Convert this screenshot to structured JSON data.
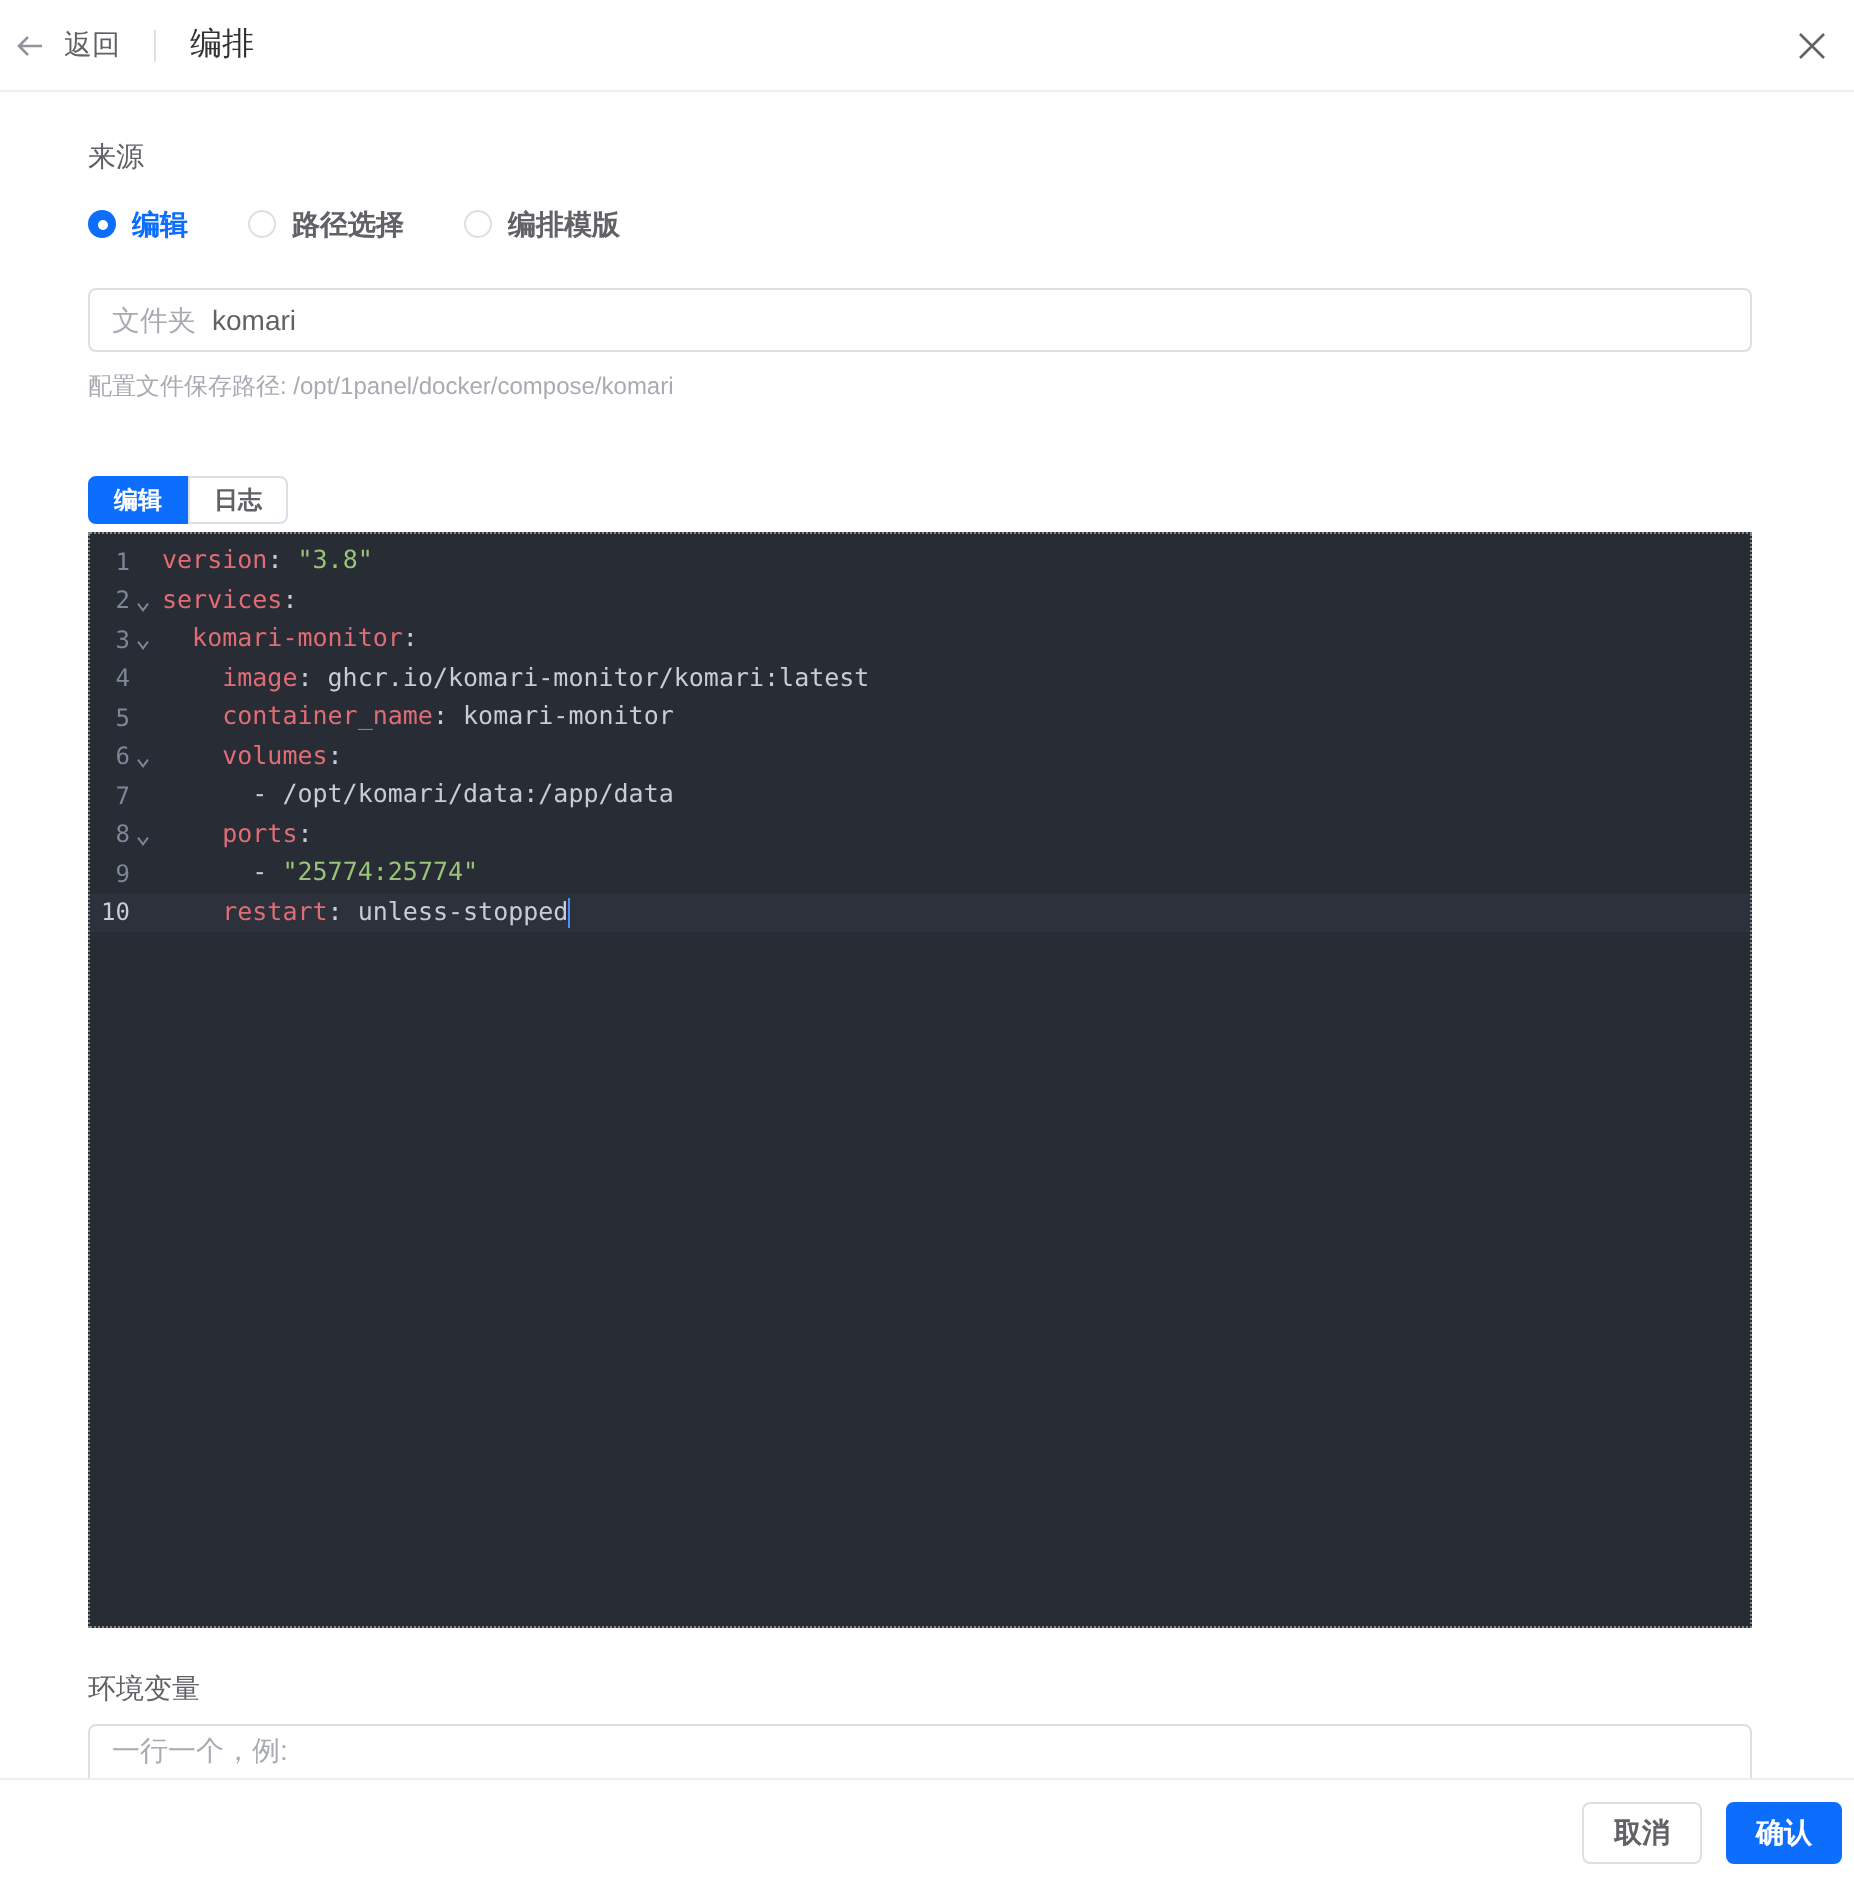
{
  "header": {
    "back": "返回",
    "title": "编排"
  },
  "source": {
    "label": "来源",
    "options": [
      {
        "label": "编辑",
        "selected": true
      },
      {
        "label": "路径选择",
        "selected": false
      },
      {
        "label": "编排模版",
        "selected": false
      }
    ]
  },
  "folder": {
    "prefix": "文件夹",
    "value": "komari"
  },
  "hint": "配置文件保存路径: /opt/1panel/docker/compose/komari",
  "editor_tabs": [
    {
      "label": "编辑",
      "selected": true
    },
    {
      "label": "日志",
      "selected": false
    }
  ],
  "code_lines": [
    {
      "number": "1",
      "foldable": false,
      "active": false,
      "segments": [
        {
          "kind": "key",
          "text": "version"
        },
        {
          "kind": "plain",
          "text": ": "
        },
        {
          "kind": "string",
          "text": "\"3.8\""
        }
      ]
    },
    {
      "number": "2",
      "foldable": true,
      "active": false,
      "segments": [
        {
          "kind": "key",
          "text": "services"
        },
        {
          "kind": "plain",
          "text": ":"
        }
      ]
    },
    {
      "number": "3",
      "foldable": true,
      "active": false,
      "segments": [
        {
          "kind": "key",
          "text": "  komari-monitor"
        },
        {
          "kind": "plain",
          "text": ":"
        }
      ]
    },
    {
      "number": "4",
      "foldable": false,
      "active": false,
      "segments": [
        {
          "kind": "key",
          "text": "    image"
        },
        {
          "kind": "plain",
          "text": ": ghcr.io/komari-monitor/komari:latest"
        }
      ]
    },
    {
      "number": "5",
      "foldable": false,
      "active": false,
      "segments": [
        {
          "kind": "key",
          "text": "    container_name"
        },
        {
          "kind": "plain",
          "text": ": komari-monitor"
        }
      ]
    },
    {
      "number": "6",
      "foldable": true,
      "active": false,
      "segments": [
        {
          "kind": "key",
          "text": "    volumes"
        },
        {
          "kind": "plain",
          "text": ":"
        }
      ]
    },
    {
      "number": "7",
      "foldable": false,
      "active": false,
      "segments": [
        {
          "kind": "plain",
          "text": "      - /opt/komari/data:/app/data"
        }
      ]
    },
    {
      "number": "8",
      "foldable": true,
      "active": false,
      "segments": [
        {
          "kind": "key",
          "text": "    ports"
        },
        {
          "kind": "plain",
          "text": ":"
        }
      ]
    },
    {
      "number": "9",
      "foldable": false,
      "active": false,
      "segments": [
        {
          "kind": "plain",
          "text": "      - "
        },
        {
          "kind": "string",
          "text": "\"25774:25774\""
        }
      ]
    },
    {
      "number": "10",
      "foldable": false,
      "active": true,
      "segments": [
        {
          "kind": "key",
          "text": "    restart"
        },
        {
          "kind": "plain",
          "text": ": unless-stopped"
        }
      ]
    }
  ],
  "env": {
    "label": "环境变量",
    "placeholder": "一行一个，例:"
  },
  "buttons": [
    {
      "label": "取消",
      "kind": "secondary"
    },
    {
      "label": "确认",
      "kind": "primary"
    }
  ]
}
